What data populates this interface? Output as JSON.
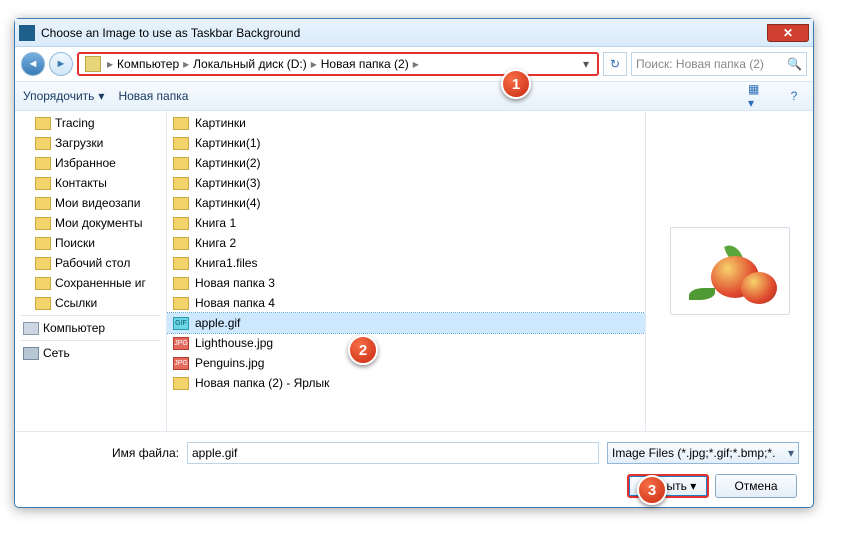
{
  "window": {
    "title": "Choose an Image to use as Taskbar Background"
  },
  "breadcrumb": {
    "root": "Компьютер",
    "drive": "Локальный диск (D:)",
    "folder": "Новая папка (2)"
  },
  "search": {
    "placeholder": "Поиск: Новая папка (2)"
  },
  "toolbar": {
    "organize": "Упорядочить",
    "newfolder": "Новая папка"
  },
  "tree": {
    "items": [
      "Tracing",
      "Загрузки",
      "Избранное",
      "Контакты",
      "Мои видеозапи",
      "Мои документы",
      "Поиски",
      "Рабочий стол",
      "Сохраненные иг",
      "Ссылки"
    ],
    "computer": "Компьютер",
    "network": "Сеть"
  },
  "list": {
    "folders": [
      "Картинки",
      "Картинки(1)",
      "Картинки(2)",
      "Картинки(3)",
      "Картинки(4)",
      "Книга 1",
      "Книга 2",
      "Книга1.files",
      "Новая папка 3",
      "Новая папка 4"
    ],
    "selected": "apple.gif",
    "files": [
      "Lighthouse.jpg",
      "Penguins.jpg"
    ],
    "shortcut": "Новая папка (2) - Ярлык"
  },
  "footer": {
    "filelabel": "Имя файла:",
    "filename": "apple.gif",
    "filter": "Image Files (*.jpg;*.gif;*.bmp;*.",
    "open": "Открыть",
    "cancel": "Отмена"
  },
  "badges": {
    "b1": "1",
    "b2": "2",
    "b3": "3"
  }
}
